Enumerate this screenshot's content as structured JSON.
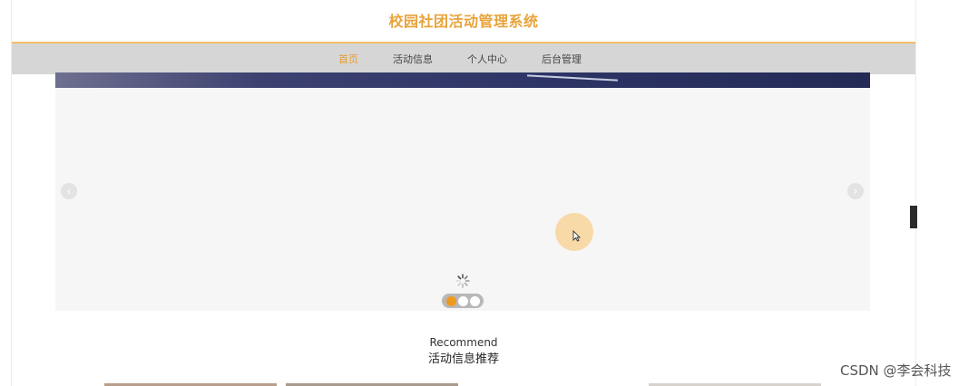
{
  "header": {
    "site_title": "校园社团活动管理系统"
  },
  "nav": {
    "items": [
      {
        "label": "首页",
        "active": true
      },
      {
        "label": "活动信息",
        "active": false
      },
      {
        "label": "个人中心",
        "active": false
      },
      {
        "label": "后台管理",
        "active": false
      }
    ]
  },
  "carousel": {
    "prev_icon": "chevron-left-icon",
    "next_icon": "chevron-right-icon",
    "prev_glyph": "‹",
    "next_glyph": "›",
    "slide_count": 3,
    "active_slide": 1,
    "loading": true
  },
  "recommend": {
    "title": "Recommend",
    "subtitle": "活动信息推荐"
  },
  "watermark": {
    "text": "CSDN @李会科技"
  },
  "colors": {
    "accent": "#e8a33b",
    "nav_bg": "#d6d6d6",
    "active_dot": "#ef9a1c",
    "carousel_bg": "#f6f6f6"
  }
}
